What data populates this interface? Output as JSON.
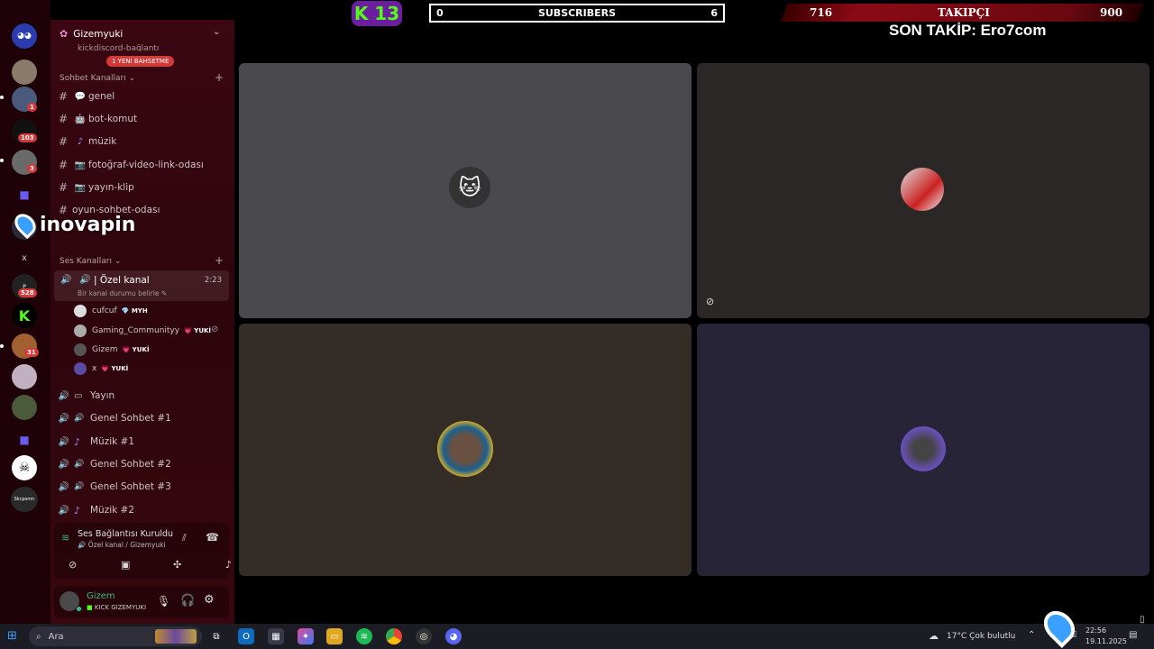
{
  "overlay": {
    "kick_logo": "K 13",
    "subs_left": "0",
    "subs_label": "SUBSCRIBERS",
    "subs_right": "6",
    "followers_left": "716",
    "followers_label": "TAKIPÇI",
    "followers_right": "900",
    "last_follow": "SON TAKİP: Ero7com",
    "inova_logo": "inovapin"
  },
  "rail": {
    "badges": [
      "1",
      "103",
      "3",
      "528",
      "31"
    ],
    "x_label": "x",
    "bottom_label": "Skcpsmn"
  },
  "server": {
    "name": "Gizemyuki",
    "truncated_channel": "kickdiscord-bağlantı",
    "new_mention": "1 YENİ BAHSETME"
  },
  "text_category": "Sohbet Kanalları",
  "text_channels": [
    {
      "label": "genel",
      "icon": "💬"
    },
    {
      "label": "bot-komut",
      "icon": "🤖"
    },
    {
      "label": "müzik",
      "icon": "♪"
    },
    {
      "label": "fotoğraf-video-link-odası",
      "icon": "📷"
    },
    {
      "label": "yayın-klip",
      "icon": "📷"
    },
    {
      "label": "oyun-sohbet-odası",
      "icon": ""
    }
  ],
  "voice_category": "Ses Kanalları",
  "active_voice": {
    "label": "Özel kanal",
    "time": "2:23",
    "status_hint": "Bir kanal durumu belirle"
  },
  "voice_users": [
    {
      "name": "cufcuf",
      "tag": "MYH",
      "color": "#d8d8d8"
    },
    {
      "name": "Gaming_Communityy",
      "tag": "YUKİ",
      "color": "#b8b8b8"
    },
    {
      "name": "Gizem",
      "tag": "YUKİ",
      "color": "#5a5a5a"
    },
    {
      "name": "x",
      "tag": "YUKİ",
      "color": "#5a4aa0"
    }
  ],
  "voice_channels": [
    {
      "label": "Yayın",
      "icon": "▭"
    },
    {
      "label": "Genel Sohbet #1",
      "icon": "🔊"
    },
    {
      "label": "Müzik #1",
      "icon": "♪"
    },
    {
      "label": "Genel Sohbet #2",
      "icon": "🔊"
    },
    {
      "label": "Genel Sohbet #3",
      "icon": "🔊"
    },
    {
      "label": "Müzik #2",
      "icon": "♪"
    }
  ],
  "voice_panel": {
    "title": "Ses Bağlantısı Kuruldu",
    "subtitle": "Özel kanal / Gizemyuki"
  },
  "user_panel": {
    "name": "Gizem",
    "status": "KICK GIZEMYUKI"
  },
  "taskbar": {
    "search_placeholder": "Ara",
    "weather": "17°C  Çok bulutlu",
    "time": "22:56",
    "date": "19.11.2025"
  },
  "colors": {
    "sidebar": "#360610",
    "mention": "#d23a3a",
    "connected_green": "#43b581",
    "kick_green": "#53fc18"
  }
}
